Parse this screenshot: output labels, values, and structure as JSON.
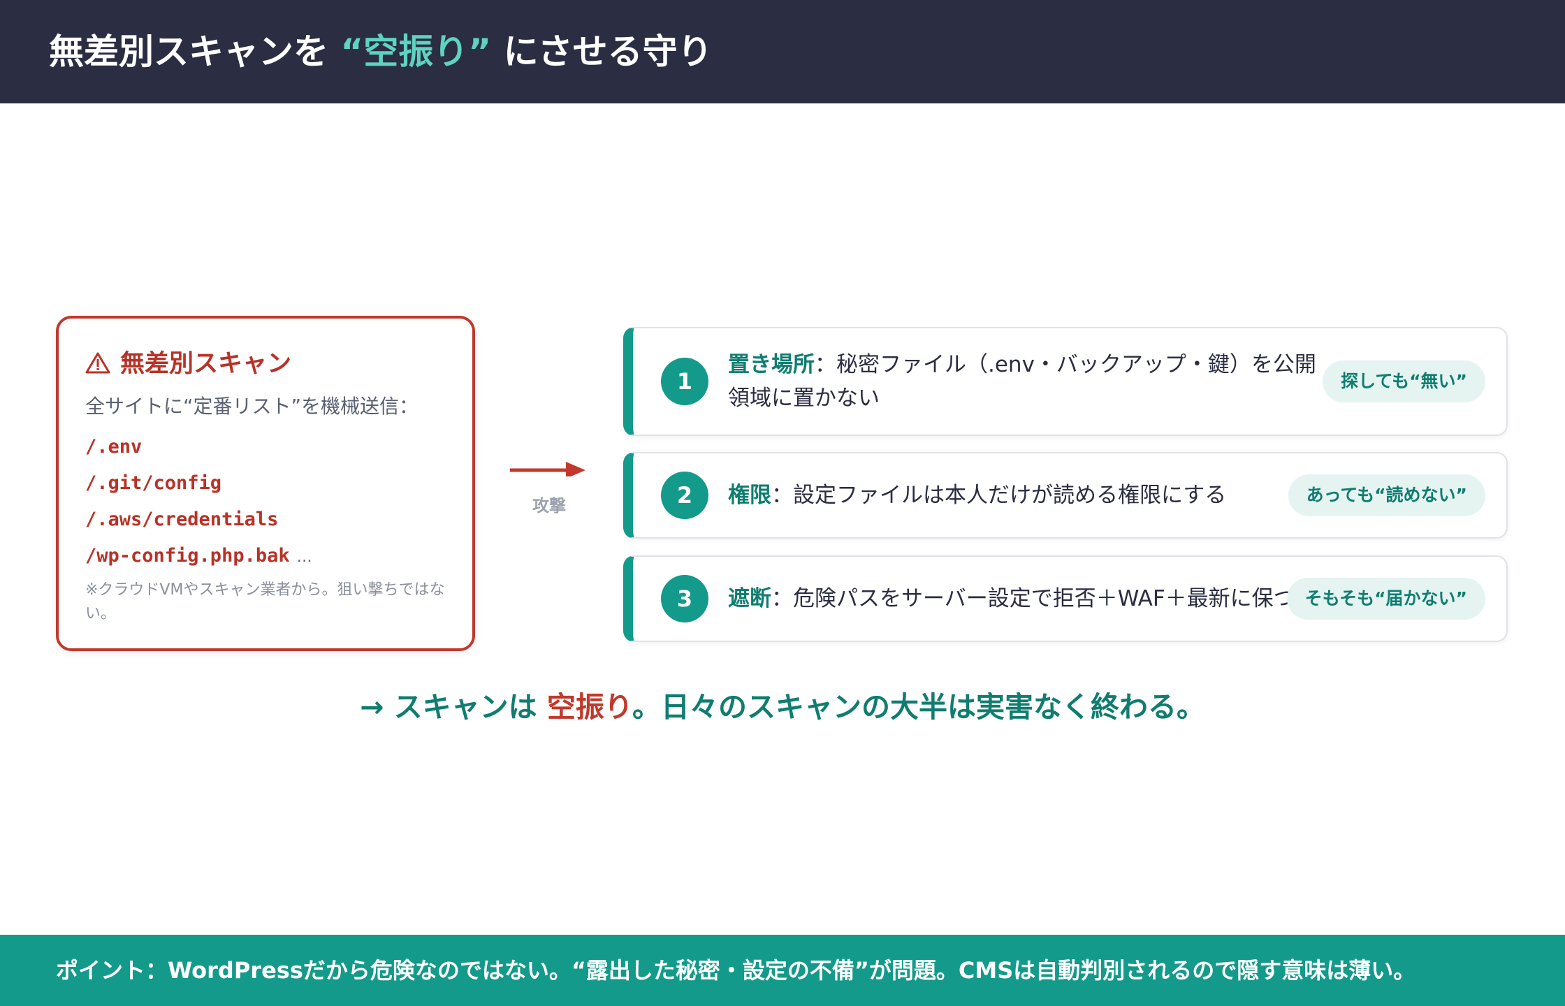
{
  "header": {
    "title_pre": "無差別スキャンを ",
    "title_accent": "“空振り”",
    "title_post": " にさせる守り"
  },
  "scan_card": {
    "title": "無差別スキャン",
    "lead": "全サイトに“定番リスト”を機械送信：",
    "paths": [
      "/.env",
      "/.git/config",
      "/.aws/credentials",
      "/wp-config.php.bak"
    ],
    "ellipsis": "…",
    "note": "※クラウドVMやスキャン業者から。狙い撃ちではない。"
  },
  "arrow": {
    "label": "攻撃"
  },
  "defenses": [
    {
      "number": "1",
      "label": "置き場所",
      "text": "：秘密ファイル（.env・バックアップ・鍵）を公開領域に置かない",
      "pill": "探しても“無い”"
    },
    {
      "number": "2",
      "label": "権限",
      "text": "：設定ファイルは本人だけが読める権限にする",
      "pill": "あっても“読めない”"
    },
    {
      "number": "3",
      "label": "遮断",
      "text": "：危険パスをサーバー設定で拒否＋WAF＋最新に保つ",
      "pill": "そもそも“届かない”"
    }
  ],
  "conclusion": {
    "pre": "→ スキャンは ",
    "highlight": "空振り",
    "post": "。日々のスキャンの大半は実害なく終わる。"
  },
  "footer": {
    "text": "ポイント：WordPressだから危険なのではない。“露出した秘密・設定の不備”が問題。CMSは自動判別されるので隠す意味は薄い。"
  },
  "colors": {
    "header_bg": "#2b2d42",
    "header_accent": "#5ed3c0",
    "danger": "#c0392b",
    "teal": "#139a8a",
    "teal_dark": "#0f7d70",
    "pill_bg": "#e5f4f1"
  },
  "icons": {
    "warning": "warning-triangle-icon",
    "arrow": "arrow-right-icon"
  }
}
